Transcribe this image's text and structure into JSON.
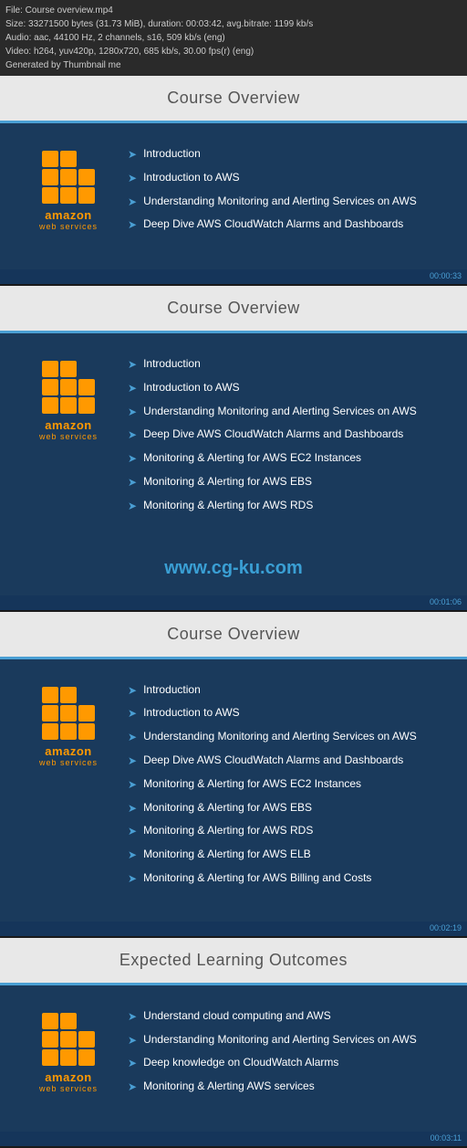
{
  "file_info": {
    "line1": "File: Course overview.mp4",
    "line2": "Size: 33271500 bytes (31.73 MiB), duration: 00:03:42, avg.bitrate: 1199 kb/s",
    "line3": "Audio: aac, 44100 Hz, 2 channels, s16, 509 kb/s (eng)",
    "line4": "Video: h264, yuv420p, 1280x720, 685 kb/s, 30.00 fps(r) (eng)",
    "line5": "Generated by Thumbnail me"
  },
  "panels": [
    {
      "id": "panel1",
      "title": "Course Overview",
      "timestamp": "00:00:33",
      "bullets": [
        "Introduction",
        "Introduction to AWS",
        "Understanding Monitoring and Alerting Services on AWS",
        "Deep Dive AWS CloudWatch Alarms and Dashboards"
      ],
      "watermark": null
    },
    {
      "id": "panel2",
      "title": "Course Overview",
      "timestamp": "00:01:06",
      "bullets": [
        "Introduction",
        "Introduction to AWS",
        "Understanding Monitoring and Alerting Services on AWS",
        "Deep Dive AWS CloudWatch Alarms and Dashboards",
        "Monitoring & Alerting for AWS EC2 Instances",
        "Monitoring & Alerting for AWS EBS",
        "Monitoring & Alerting for AWS RDS"
      ],
      "watermark": "www.cg-ku.com"
    },
    {
      "id": "panel3",
      "title": "Course Overview",
      "timestamp": "00:02:19",
      "bullets": [
        "Introduction",
        "Introduction to AWS",
        "Understanding Monitoring and Alerting Services on AWS",
        "Deep Dive AWS CloudWatch Alarms and Dashboards",
        "Monitoring & Alerting for AWS EC2 Instances",
        "Monitoring & Alerting for AWS EBS",
        "Monitoring & Alerting for AWS RDS",
        "Monitoring & Alerting for AWS ELB",
        "Monitoring & Alerting for AWS Billing and Costs"
      ],
      "watermark": null
    },
    {
      "id": "panel4",
      "title": "Expected Learning Outcomes",
      "timestamp": "00:03:11",
      "bullets": [
        "Understand cloud computing and AWS",
        "Understanding Monitoring and Alerting Services on AWS",
        "Deep knowledge on CloudWatch Alarms",
        "Monitoring & Alerting AWS services"
      ],
      "watermark": null
    }
  ],
  "aws_logo": {
    "brand": "amazon",
    "sub": "web services"
  }
}
